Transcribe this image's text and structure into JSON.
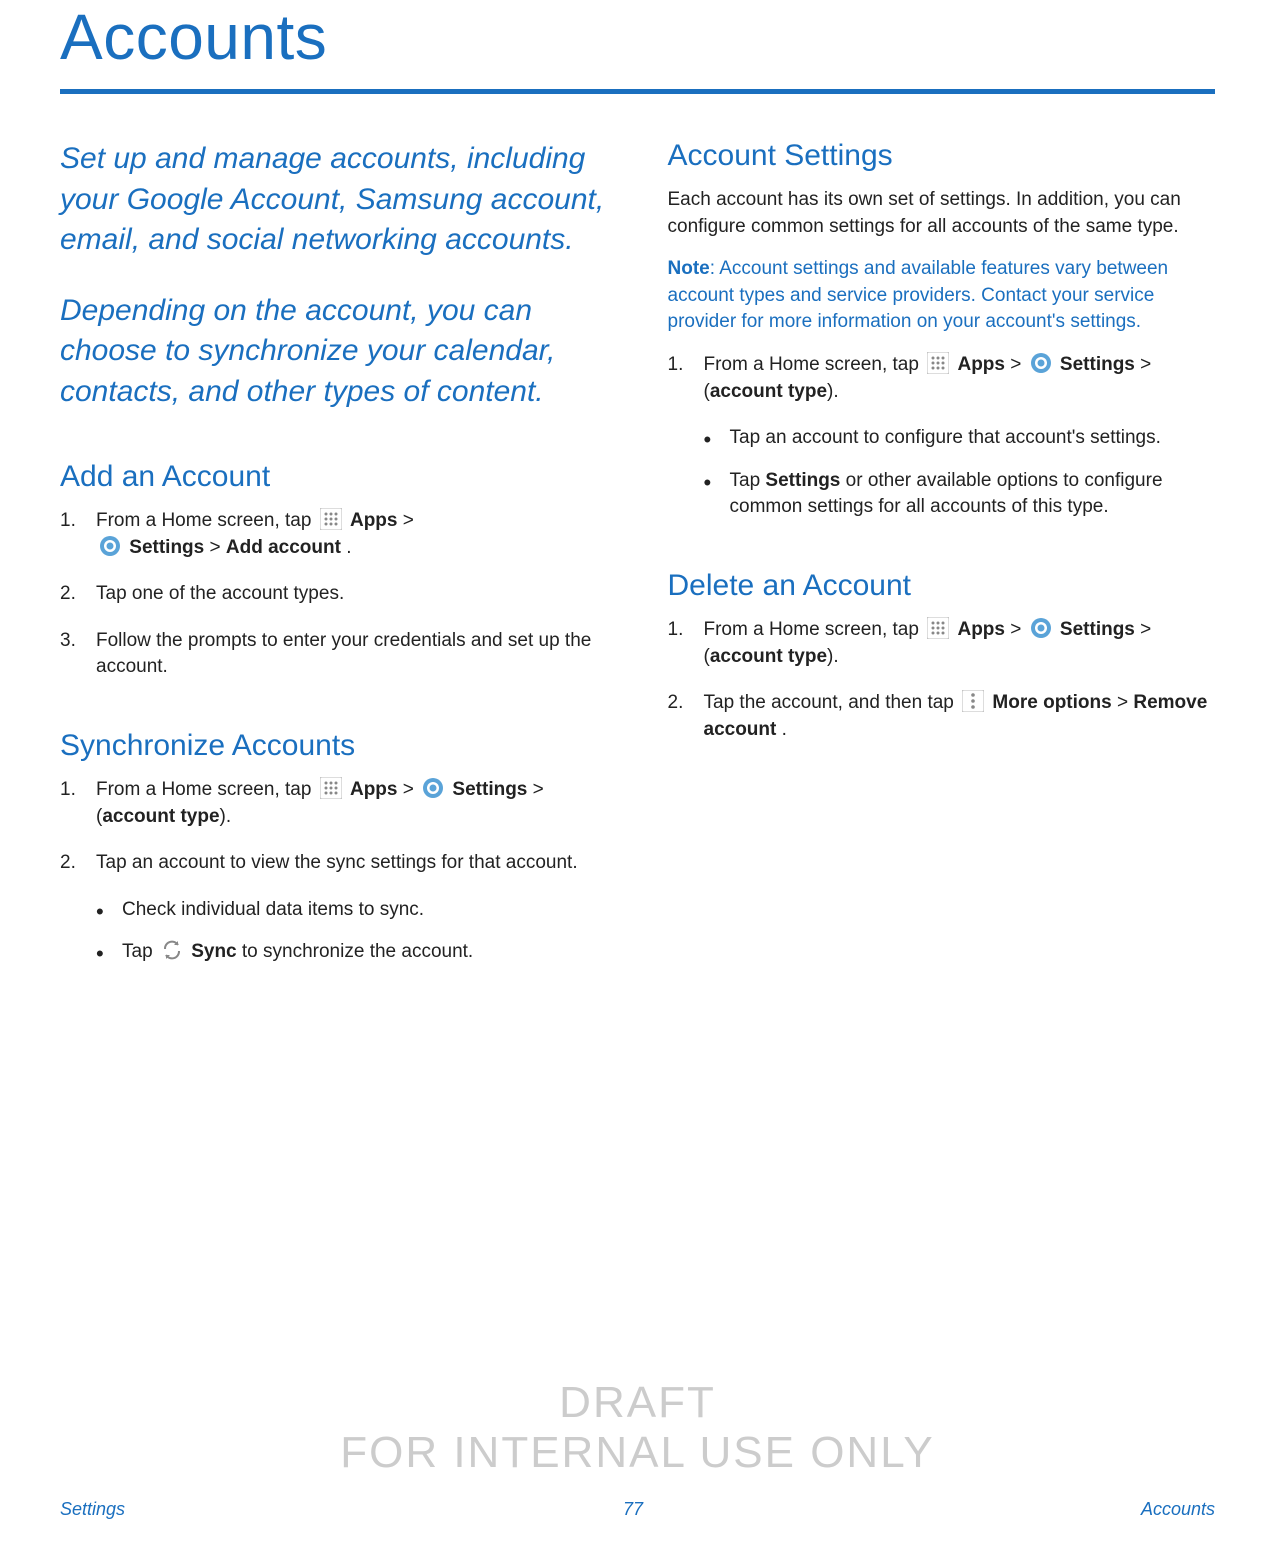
{
  "page_title": "Accounts",
  "intro": {
    "p1": "Set up and manage accounts, including your Google Account, Samsung account, email, and social networking accounts.",
    "p2": "Depending on the account, you can choose to synchronize your calendar, contacts, and other types of content."
  },
  "add_account": {
    "heading": "Add an Account",
    "step1_pre": "From a Home screen, tap ",
    "step1_apps": "Apps",
    "step1_gt": " > ",
    "step1_settings_label": "Settings",
    "step1_gt2": " > ",
    "step1_add_account": "Add account",
    "step1_end": ".",
    "step2": "Tap one of the account types.",
    "step3": "Follow the prompts to enter your credentials and set up the account."
  },
  "sync_accounts": {
    "heading": "Synchronize Accounts",
    "step1_pre": "From a Home screen, tap ",
    "step1_apps": "Apps",
    "step1_gt": " > ",
    "step1_settings_label": "Settings",
    "step1_gt2": " > (",
    "step1_account_type": "account type",
    "step1_end": ").",
    "step2": "Tap an account to view the sync settings for that account.",
    "bullet1": "Check individual data items to sync.",
    "bullet2_pre": "Tap ",
    "bullet2_sync": "Sync",
    "bullet2_post": " to synchronize the account."
  },
  "account_settings": {
    "heading": "Account Settings",
    "intro": "Each account has its own set of settings. In addition, you can configure common settings for all accounts of the same type.",
    "note_label": "Note",
    "note_text": ": Account settings and available features vary between account types and service providers. Contact your service provider for more information on your account's settings.",
    "step1_pre": "From a Home screen, tap ",
    "step1_apps": "Apps",
    "step1_gt": " > ",
    "step1_settings_label": "Settings",
    "step1_gt2": " > (",
    "step1_account_type": "account type",
    "step1_end": ").",
    "bullet1": "Tap an account to configure that account's settings.",
    "bullet2_pre": "Tap ",
    "bullet2_settings": "Settings",
    "bullet2_post": " or other available options to configure common settings for all accounts of this type."
  },
  "delete_account": {
    "heading": "Delete an Account",
    "step1_pre": "From a Home screen, tap ",
    "step1_apps": "Apps",
    "step1_gt": " > ",
    "step1_settings_label": "Settings",
    "step1_gt2": " > (",
    "step1_account_type": "account type",
    "step1_end": ").",
    "step2_pre": "Tap the account, and then tap ",
    "step2_more": "More options",
    "step2_gt": " > ",
    "step2_remove": "Remove account",
    "step2_end": "."
  },
  "watermark": {
    "line1": "DRAFT",
    "line2": "FOR INTERNAL USE ONLY"
  },
  "footer": {
    "left": "Settings",
    "center": "77",
    "right": "Accounts"
  }
}
